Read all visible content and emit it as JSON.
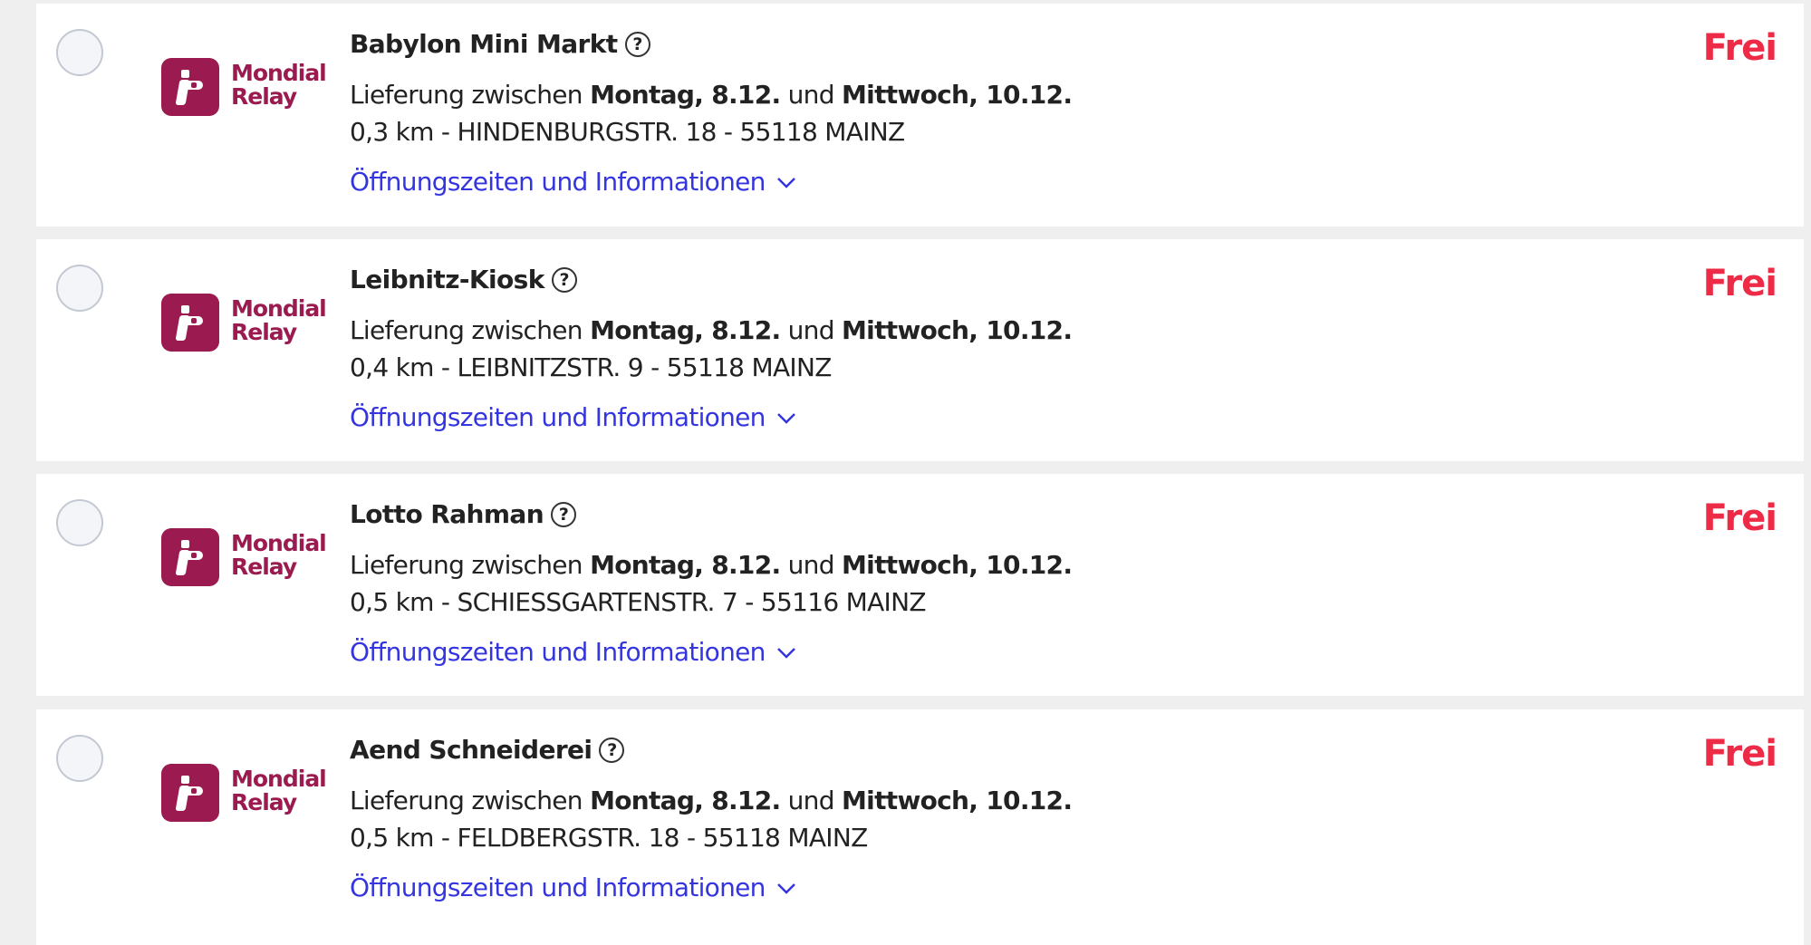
{
  "delivery_prefix": "Lieferung zwischen",
  "delivery_connector": "und",
  "info_link_label": "Öffnungszeiten und Informationen",
  "carrier": {
    "name_line1": "Mondial",
    "name_line2": "Relay",
    "brand_color": "#9b1a4f"
  },
  "price_color": "#ee2b47",
  "link_color": "#3535e0",
  "pickup_points": [
    {
      "name": "Babylon Mini Markt",
      "date_from": "Montag, 8.12.",
      "date_to": "Mittwoch, 10.12.",
      "address": "0,3 km - HINDENBURGSTR. 18 - 55118 MAINZ",
      "price": "Frei"
    },
    {
      "name": "Leibnitz-Kiosk",
      "date_from": "Montag, 8.12.",
      "date_to": "Mittwoch, 10.12.",
      "address": "0,4 km - LEIBNITZSTR. 9 - 55118 MAINZ",
      "price": "Frei"
    },
    {
      "name": "Lotto Rahman",
      "date_from": "Montag, 8.12.",
      "date_to": "Mittwoch, 10.12.",
      "address": "0,5 km - SCHIESSGARTENSTR. 7 - 55116 MAINZ",
      "price": "Frei"
    },
    {
      "name": "Aend Schneiderei",
      "date_from": "Montag, 8.12.",
      "date_to": "Mittwoch, 10.12.",
      "address": "0,5 km - FELDBERGSTR. 18 - 55118 MAINZ",
      "price": "Frei"
    }
  ]
}
